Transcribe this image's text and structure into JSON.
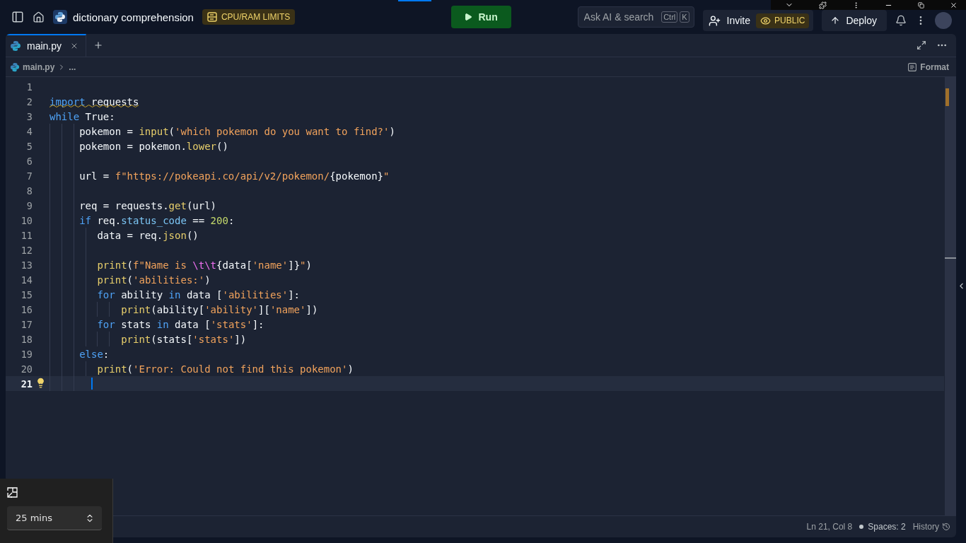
{
  "topbar": {
    "title": "dictionary comprehension",
    "badge": "CPU/RAM LIMITS",
    "run": "Run",
    "search": {
      "placeholder": "Ask AI & search",
      "keys": [
        "Ctrl",
        "K"
      ]
    },
    "invite": "Invite",
    "visibility": "PUBLIC",
    "deploy": "Deploy"
  },
  "tabs": [
    {
      "label": "main.py",
      "selected": true
    }
  ],
  "breadcrumb": [
    "main.py",
    "..."
  ],
  "format": "Format",
  "code": {
    "lines": [
      {
        "number": "1",
        "current": false
      },
      {
        "number": "2",
        "current": false,
        "warning": true,
        "tokens": [
          {
            "kind": "kw",
            "text": "import"
          },
          {
            "kind": "plain",
            "text": " requests"
          }
        ]
      },
      {
        "number": "3",
        "current": false,
        "warning": false,
        "tokens": [
          {
            "kind": "kw",
            "text": "while"
          },
          {
            "kind": "plain",
            "text": " True:"
          }
        ],
        "children": [
          {
            "number": "4",
            "current": false,
            "warning": false,
            "tokens": [
              {
                "kind": "plain",
                "text": "pokemon = "
              },
              {
                "kind": "fn",
                "text": "input"
              },
              {
                "kind": "plain",
                "text": "("
              },
              {
                "kind": "str",
                "text": "'which pokemon do you want to find?'"
              },
              {
                "kind": "plain",
                "text": ")"
              }
            ]
          },
          {
            "number": "5",
            "current": false,
            "warning": false,
            "tokens": [
              {
                "kind": "plain",
                "text": "pokemon = pokemon."
              },
              {
                "kind": "fn",
                "text": "lower"
              },
              {
                "kind": "plain",
                "text": "()"
              }
            ]
          },
          {
            "number": "6",
            "current": false
          },
          {
            "number": "7",
            "current": false,
            "warning": false,
            "tokens": [
              {
                "kind": "plain",
                "text": "url = "
              },
              {
                "kind": "str",
                "text": "f\"https://pokeapi.co/api/v2/pokemon/"
              },
              {
                "kind": "plain",
                "text": "{pokemon}"
              },
              {
                "kind": "str",
                "text": "\""
              }
            ]
          },
          {
            "number": "8",
            "current": false
          },
          {
            "number": "9",
            "current": false,
            "warning": false,
            "tokens": [
              {
                "kind": "plain",
                "text": "req = requests."
              },
              {
                "kind": "fn",
                "text": "get"
              },
              {
                "kind": "plain",
                "text": "(url)"
              }
            ]
          },
          {
            "number": "10",
            "current": false,
            "warning": false,
            "tokens": [
              {
                "kind": "kw",
                "text": "if"
              },
              {
                "kind": "plain",
                "text": " req."
              },
              {
                "kind": "attr",
                "text": "status_code"
              },
              {
                "kind": "plain",
                "text": " == "
              },
              {
                "kind": "num",
                "text": "200"
              },
              {
                "kind": "plain",
                "text": ":"
              }
            ],
            "children": [
              {
                "number": "11",
                "current": false,
                "warning": false,
                "tokens": [
                  {
                    "kind": "plain",
                    "text": "data = req."
                  },
                  {
                    "kind": "fn",
                    "text": "json"
                  },
                  {
                    "kind": "plain",
                    "text": "()"
                  }
                ]
              },
              {
                "number": "12",
                "current": false
              },
              {
                "number": "13",
                "current": false,
                "warning": false,
                "tokens": [
                  {
                    "kind": "fn",
                    "text": "print"
                  },
                  {
                    "kind": "plain",
                    "text": "("
                  },
                  {
                    "kind": "str",
                    "text": "f\"Name is "
                  },
                  {
                    "kind": "esc",
                    "text": "\\t\\t"
                  },
                  {
                    "kind": "plain",
                    "text": "{data["
                  },
                  {
                    "kind": "str",
                    "text": "'name'"
                  },
                  {
                    "kind": "plain",
                    "text": "]}"
                  },
                  {
                    "kind": "str",
                    "text": "\""
                  },
                  {
                    "kind": "plain",
                    "text": ")"
                  }
                ]
              },
              {
                "number": "14",
                "current": false,
                "warning": false,
                "tokens": [
                  {
                    "kind": "fn",
                    "text": "print"
                  },
                  {
                    "kind": "plain",
                    "text": "("
                  },
                  {
                    "kind": "str",
                    "text": "'abilities:'"
                  },
                  {
                    "kind": "plain",
                    "text": ")"
                  }
                ]
              },
              {
                "number": "15",
                "current": false,
                "warning": false,
                "tokens": [
                  {
                    "kind": "kw",
                    "text": "for"
                  },
                  {
                    "kind": "plain",
                    "text": " ability "
                  },
                  {
                    "kind": "kw",
                    "text": "in"
                  },
                  {
                    "kind": "plain",
                    "text": " data ["
                  },
                  {
                    "kind": "str",
                    "text": "'abilities'"
                  },
                  {
                    "kind": "plain",
                    "text": "]:"
                  }
                ],
                "children": [
                  {
                    "number": "16",
                    "current": false,
                    "warning": false,
                    "tokens": [
                      {
                        "kind": "fn",
                        "text": "print"
                      },
                      {
                        "kind": "plain",
                        "text": "(ability["
                      },
                      {
                        "kind": "str",
                        "text": "'ability'"
                      },
                      {
                        "kind": "plain",
                        "text": "]["
                      },
                      {
                        "kind": "str",
                        "text": "'name'"
                      },
                      {
                        "kind": "plain",
                        "text": "])"
                      }
                    ]
                  }
                ]
              },
              {
                "number": "17",
                "current": false,
                "warning": false,
                "tokens": [
                  {
                    "kind": "kw",
                    "text": "for"
                  },
                  {
                    "kind": "plain",
                    "text": " stats "
                  },
                  {
                    "kind": "kw",
                    "text": "in"
                  },
                  {
                    "kind": "plain",
                    "text": " data ["
                  },
                  {
                    "kind": "str",
                    "text": "'stats'"
                  },
                  {
                    "kind": "plain",
                    "text": "]:"
                  }
                ],
                "children": [
                  {
                    "number": "18",
                    "current": false,
                    "warning": false,
                    "tokens": [
                      {
                        "kind": "fn",
                        "text": "print"
                      },
                      {
                        "kind": "plain",
                        "text": "(stats["
                      },
                      {
                        "kind": "str",
                        "text": "'stats'"
                      },
                      {
                        "kind": "plain",
                        "text": "])"
                      }
                    ]
                  }
                ]
              }
            ]
          },
          {
            "number": "19",
            "current": false,
            "warning": false,
            "tokens": [
              {
                "kind": "kw",
                "text": "else"
              },
              {
                "kind": "plain",
                "text": ":"
              }
            ],
            "children": [
              {
                "number": "20",
                "current": false,
                "warning": false,
                "tokens": [
                  {
                    "kind": "fn",
                    "text": "print"
                  },
                  {
                    "kind": "plain",
                    "text": "("
                  },
                  {
                    "kind": "str",
                    "text": "'Error: Could not find this pokemon'"
                  },
                  {
                    "kind": "plain",
                    "text": ")"
                  }
                ]
              }
            ]
          },
          {
            "number": "21",
            "current": true
          }
        ]
      }
    ]
  },
  "status": {
    "position": "Ln 21, Col 8",
    "spaces": "Spaces: 2",
    "history": "History"
  },
  "timer": {
    "value": "25 mins"
  }
}
